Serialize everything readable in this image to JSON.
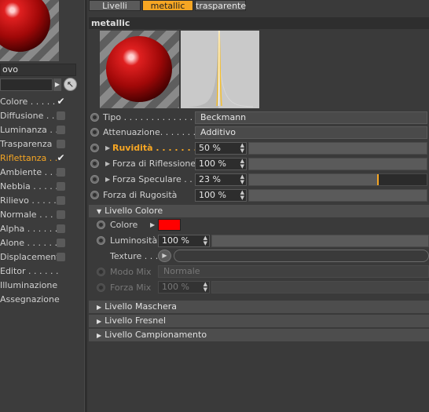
{
  "tabs": [
    {
      "label": "Livelli",
      "active": false
    },
    {
      "label": "metallic",
      "active": true
    },
    {
      "label": "trasparente",
      "active": false
    }
  ],
  "left_panel": {
    "material_name": "ovo",
    "channels": [
      {
        "label": "Colore . . . . .",
        "checked": true,
        "active": false
      },
      {
        "label": "Diffusione . .",
        "checked": false,
        "active": false
      },
      {
        "label": "Luminanza . .",
        "checked": false,
        "active": false
      },
      {
        "label": "Trasparenza",
        "checked": false,
        "active": false
      },
      {
        "label": "Riflettanza . .",
        "checked": true,
        "active": true
      },
      {
        "label": "Ambiente . . .",
        "checked": false,
        "active": false
      },
      {
        "label": "Nebbia . . . . .",
        "checked": false,
        "active": false
      },
      {
        "label": "Rilievo . . . . .",
        "checked": false,
        "active": false
      },
      {
        "label": "Normale . . . .",
        "checked": false,
        "active": false
      },
      {
        "label": "Alpha . . . . . .",
        "checked": false,
        "active": false
      },
      {
        "label": "Alone . . . . . .",
        "checked": false,
        "active": false
      },
      {
        "label": "Displacement",
        "checked": false,
        "active": false
      },
      {
        "label": "Editor . . . . . .",
        "checked": null,
        "active": false
      },
      {
        "label": "Illuminazione",
        "checked": null,
        "active": false
      },
      {
        "label": "Assegnazione",
        "checked": null,
        "active": false
      }
    ]
  },
  "layer": {
    "title": "metallic",
    "tipo_label": "Tipo . . . . . . . . . . . . . . .",
    "tipo_value": "Beckmann",
    "attenuazione_label": "Attenuazione. . . . . . .",
    "attenuazione_value": "Additivo",
    "ruvidita_label": "Ruvidità . . . . . . . . .",
    "ruvidita_value": "50 %",
    "ruvidita_level": 0,
    "forza_riflessione_label": "Forza di Riflessione",
    "forza_riflessione_value": "100 %",
    "forza_riflessione_level": 0,
    "forza_speculare_label": "Forza Speculare . . .",
    "forza_speculare_value": "23 %",
    "forza_speculare_level": 0.73,
    "forza_rugosita_label": "Forza di Rugosità",
    "forza_rugosita_value": "100 %",
    "forza_rugosita_level": 0
  },
  "livello_colore": {
    "header": "Livello Colore",
    "colore_label": "Colore",
    "colore_value": "#ff0000",
    "luminosita_label": "Luminosità",
    "luminosita_value": "100 %",
    "texture_label": "Texture . . .",
    "modo_mix_label": "Modo Mix",
    "modo_mix_value": "Normale",
    "forza_mix_label": "Forza Mix",
    "forza_mix_value": "100 %"
  },
  "collapsed_sections": [
    {
      "label": "Livello Maschera"
    },
    {
      "label": "Livello Fresnel"
    },
    {
      "label": "Livello Campionamento"
    }
  ],
  "colors": {
    "accent": "#f6a623",
    "panel_bg": "#3a3a3a"
  }
}
